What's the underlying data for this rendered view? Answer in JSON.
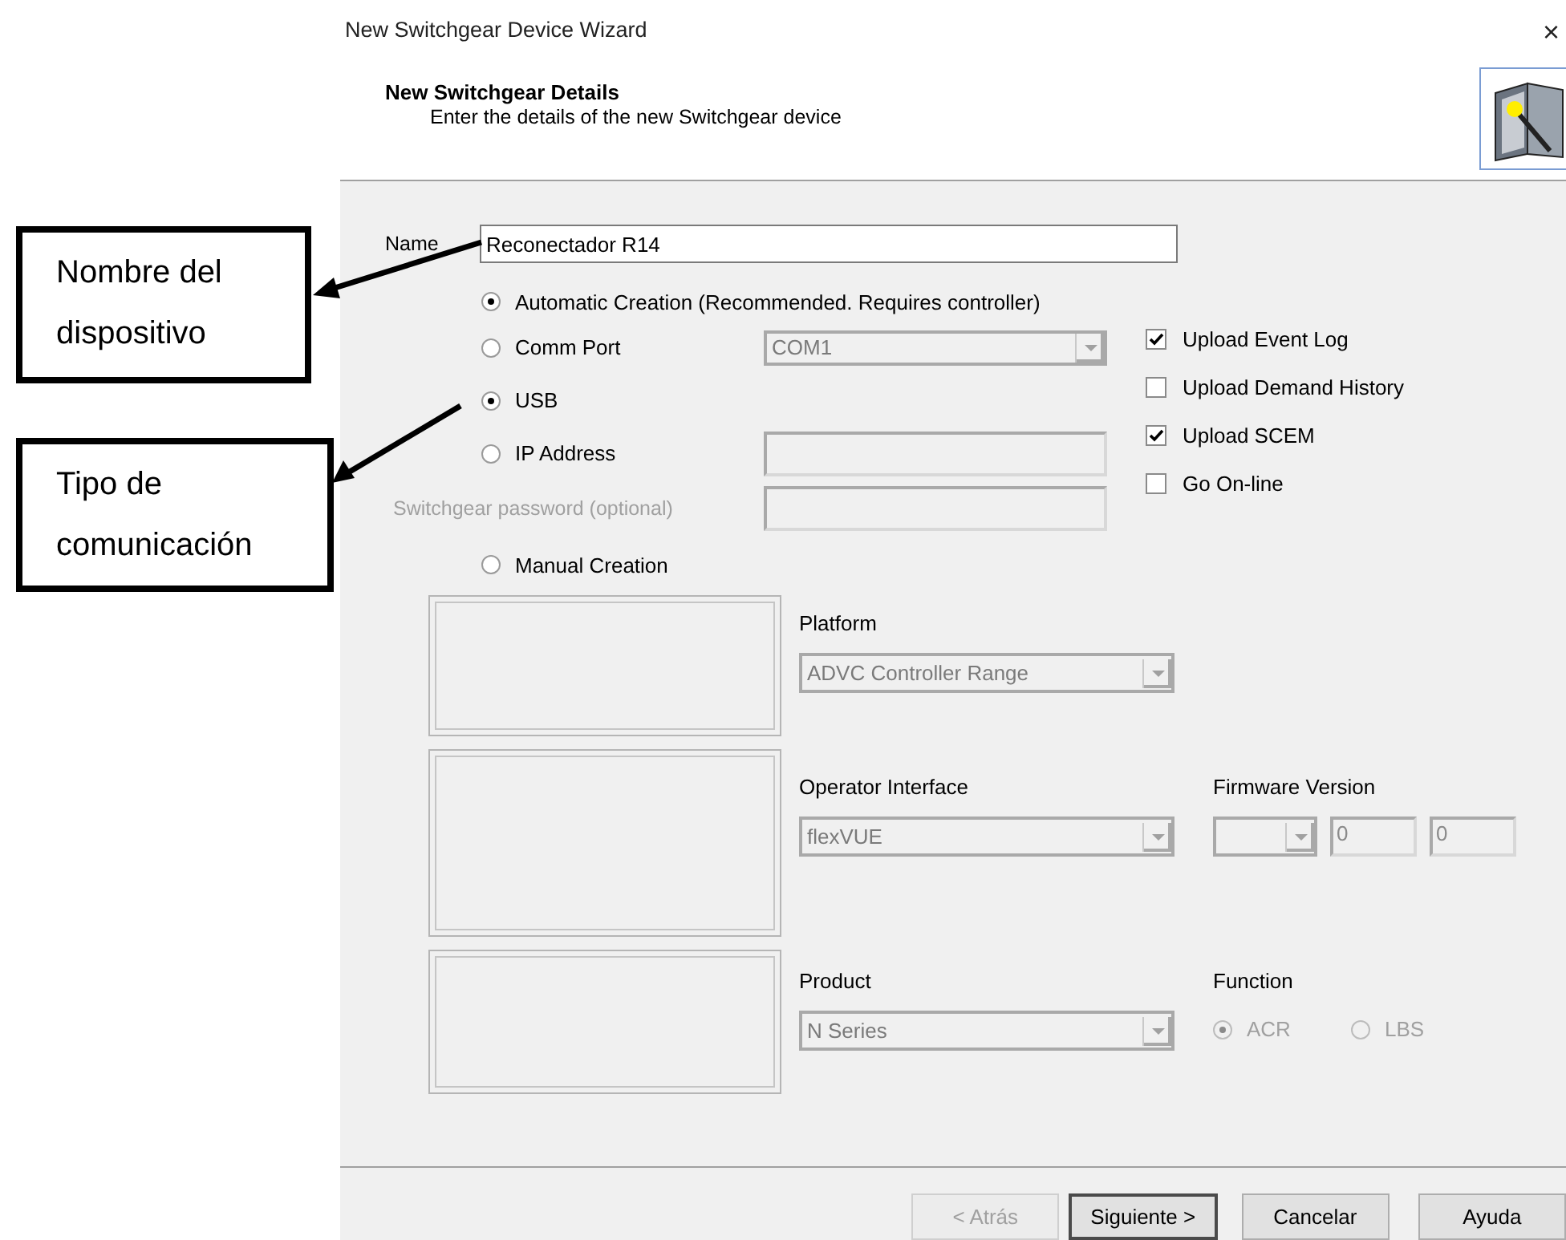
{
  "window": {
    "title": "New Switchgear Device Wizard",
    "close": "×"
  },
  "header": {
    "title": "New Switchgear Details",
    "subtitle": "Enter the details of the new Switchgear device"
  },
  "name_field": {
    "label": "Name",
    "value": "Reconectador R14"
  },
  "automatic_creation": {
    "label": "Automatic Creation (Recommended. Requires controller)",
    "selected": true
  },
  "connections": [
    {
      "kind": "combo",
      "label": "Comm Port",
      "selected": false,
      "value": "COM1"
    },
    {
      "kind": "plain",
      "label": "USB",
      "selected": true
    },
    {
      "kind": "input",
      "label": "IP Address",
      "selected": false
    }
  ],
  "password": {
    "label": "Switchgear password (optional)",
    "disabled": true
  },
  "upload_options": [
    {
      "label": "Upload Event Log",
      "checked": true
    },
    {
      "label": "Upload Demand History",
      "checked": false
    },
    {
      "label": "Upload SCEM",
      "checked": true
    },
    {
      "label": "Go On-line",
      "checked": false
    }
  ],
  "manual_creation": {
    "label": "Manual Creation",
    "selected": false
  },
  "platform": {
    "label": "Platform",
    "value": "ADVC Controller Range"
  },
  "operator_interface": {
    "label": "Operator Interface",
    "value": "flexVUE"
  },
  "firmware_version": {
    "label": "Firmware Version",
    "parts": [
      "0",
      "0"
    ]
  },
  "product": {
    "label": "Product",
    "value": "N Series"
  },
  "function": {
    "label": "Function",
    "disabled": true,
    "options": [
      {
        "label": "ACR",
        "selected": true
      },
      {
        "label": "LBS",
        "selected": false
      }
    ]
  },
  "buttons": [
    {
      "label": "< Atrás",
      "disabled": true,
      "default": false
    },
    {
      "label": "Siguiente >",
      "disabled": false,
      "default": true
    },
    {
      "label": "Cancelar",
      "disabled": false,
      "default": false
    },
    {
      "label": "Ayuda",
      "disabled": false,
      "default": false
    }
  ],
  "annotations": [
    {
      "text": "Nombre del dispositivo"
    },
    {
      "text": "Tipo de comunicación"
    }
  ]
}
